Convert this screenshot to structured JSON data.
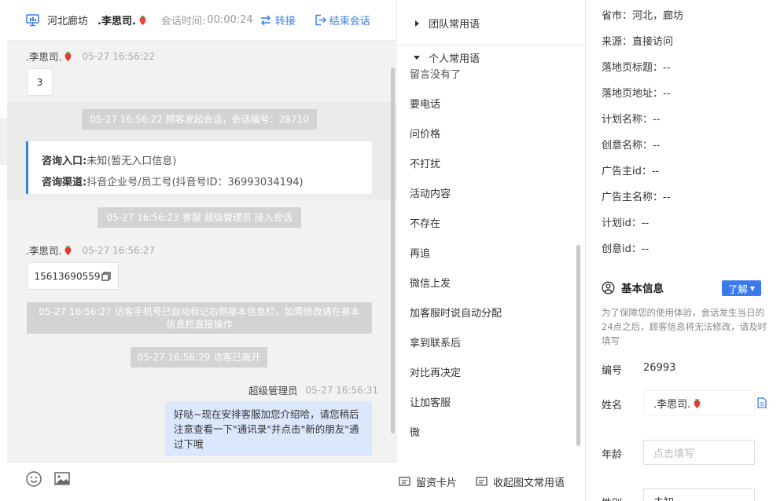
{
  "header": {
    "location": "河北廊坊",
    "visitor_name": ".李思司.",
    "session_time_label": "会话时间:",
    "session_time_value": "00:00:24",
    "transfer_label": "转接",
    "end_label": "结束会话"
  },
  "messages": {
    "m1_sender": ".李思司.",
    "m1_time": "05-27 16:56:22",
    "m1_text": "3",
    "sys1": "05-27 16:56:22 顾客发起会话，会话编号：28710",
    "card_entry_label": "咨询入口:",
    "card_entry_value": "未知(暂无入口信息)",
    "card_channel_label": "咨询渠道:",
    "card_channel_value": "抖音企业号/员工号(抖音号ID：36993034194)",
    "sys2": "05-27 16:56:23 客服 超级管理员 接入会话",
    "m2_sender": ".李思司.",
    "m2_time": "05-27 16:56:27",
    "m2_text": "15613690559",
    "sys3": "05-27 16:56:27 访客手机号已自动标记右侧基本信息栏，如需修改请在基本信息栏直接操作",
    "sys4": "05-27 16:56:29 访客已离开",
    "agent_name": "超级管理员",
    "agent_time": "05-27 16:56:31",
    "agent_text": "好哒~现在安排客服加您介绍哈，请您稍后注意查看一下\"通讯录\"并点击\"新的朋友\"通过下哦"
  },
  "phrases": {
    "team_group": "团队常用语",
    "personal_group": "个人常用语",
    "partial_item": "留言没有了",
    "items": [
      "要电话",
      "问价格",
      "不打扰",
      "活动内容",
      "不存在",
      "再追",
      "微信上发",
      "加客服时说自动分配",
      "拿到联系后",
      "对比再决定",
      "让加客服",
      "微"
    ],
    "footer_card": "留资卡片",
    "footer_collapse": "收起图文常用语"
  },
  "info": {
    "province": "省市：河北，廊坊",
    "source": "来源：直接访问",
    "landing_title": "落地页标题：--",
    "landing_url": "落地页地址：--",
    "plan_name": "计划名称：--",
    "creative_name": "创意名称：--",
    "advertiser_id": "广告主id：--",
    "advertiser_name": "广告主名称：--",
    "plan_id": "计划id：--",
    "creative_id": "创意id：--",
    "basic_title": "基本信息",
    "learn_label": "了解",
    "note": "为了保障您的使用体验，会话发生当日的24点之后，顾客信息将无法修改，请及时填写",
    "id_label": "编号",
    "id_value": "26993",
    "name_label": "姓名",
    "name_value": ".李思司.",
    "age_label": "年龄",
    "age_placeholder": "点击填写",
    "gender_label": "性别",
    "gender_value": "未知"
  },
  "colors": {
    "accent": "#3a7bea",
    "system_msg": "#d3d3d3",
    "agent_bubble": "#dbe7fd"
  },
  "icons": [
    "monitor-icon",
    "transfer-icon",
    "end-session-icon",
    "strawberry-emoji",
    "copy-icon",
    "emoji-icon",
    "image-icon",
    "card-icon",
    "collapse-icon",
    "triangle-right-icon",
    "triangle-down-icon",
    "user-circle-icon",
    "edit-icon"
  ]
}
